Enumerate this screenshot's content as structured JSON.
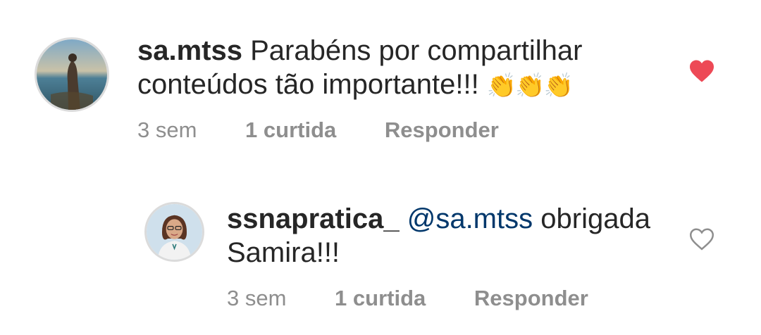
{
  "comments": [
    {
      "username": "sa.mtss",
      "text": "Parabéns por compartilhar conteúdos tão importante!!!",
      "emoji": "👏👏👏",
      "time": "3 sem",
      "likes": "1 curtida",
      "reply_label": "Responder",
      "liked": true,
      "heart_icon": "heart-filled-icon",
      "heart_color": "#ed4956"
    },
    {
      "username": "ssnapratica_",
      "mention": "@sa.mtss",
      "text": "obrigada Samira!!!",
      "time": "3 sem",
      "likes": "1 curtida",
      "reply_label": "Responder",
      "liked": false,
      "heart_icon": "heart-outline-icon",
      "heart_color": "#8e8e8e"
    }
  ]
}
